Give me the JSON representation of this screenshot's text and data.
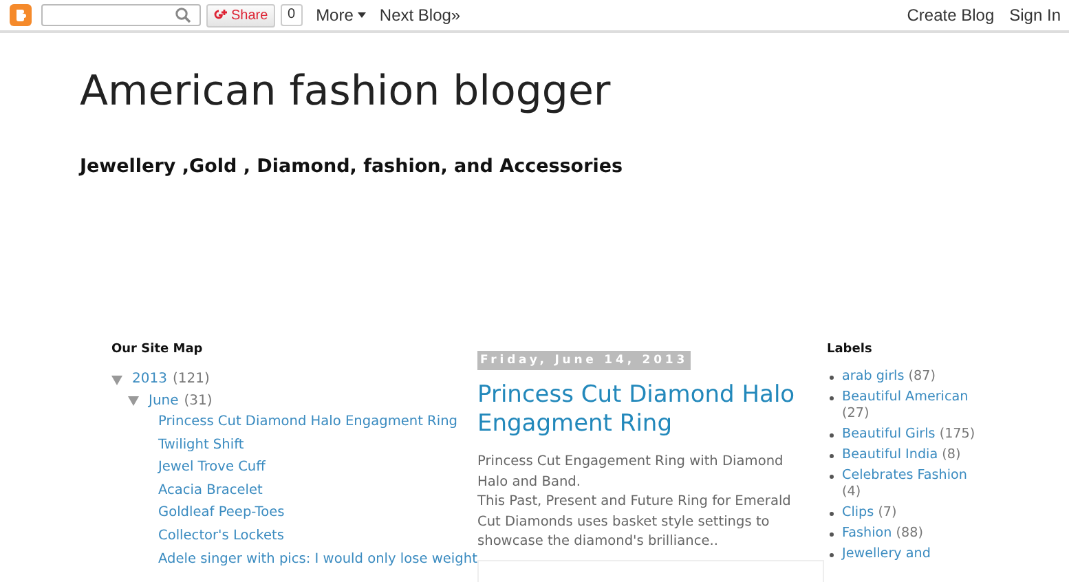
{
  "navbar": {
    "share": {
      "label": "Share",
      "count": "0"
    },
    "more": "More",
    "next_blog": "Next Blog»",
    "create_blog": "Create Blog",
    "sign_in": "Sign In"
  },
  "header": {
    "title": "American fashion blogger",
    "description": "Jewellery ,Gold , Diamond, fashion, and Accessories"
  },
  "site_map": {
    "title": "Our Site Map",
    "tree": [
      {
        "label": "2013",
        "count": "(121)",
        "expanded": true,
        "children": [
          {
            "label": "June",
            "count": "(31)",
            "expanded": true,
            "children": [
              {
                "label": "Princess Cut Diamond Halo Engagment Ring"
              },
              {
                "label": "Twilight Shift"
              },
              {
                "label": "Jewel Trove Cuff"
              },
              {
                "label": "Acacia Bracelet"
              },
              {
                "label": "Goldleaf Peep-Toes"
              },
              {
                "label": "Collector's Lockets"
              },
              {
                "label": "Adele singer with pics: I would only lose weight"
              }
            ]
          }
        ]
      }
    ]
  },
  "post": {
    "date": "Friday, June 14, 2013",
    "title": "Princess Cut Diamond Halo Engagment Ring",
    "body": [
      "Princess Cut Engagement Ring with Diamond Halo and Band.",
      "This Past, Present and Future Ring for Emerald Cut Diamonds uses basket style settings to showcase the diamond's brilliance.."
    ]
  },
  "labels": {
    "title": "Labels",
    "items": [
      {
        "name": "arab girls",
        "count": "(87)"
      },
      {
        "name": "Beautiful American",
        "count": "(27)"
      },
      {
        "name": "Beautiful Girls",
        "count": "(175)"
      },
      {
        "name": "Beautiful India",
        "count": "(8)"
      },
      {
        "name": "Celebrates Fashion",
        "count": "(4)"
      },
      {
        "name": "Clips",
        "count": "(7)"
      },
      {
        "name": "Fashion",
        "count": "(88)"
      },
      {
        "name": "Jewellery and"
      }
    ]
  }
}
